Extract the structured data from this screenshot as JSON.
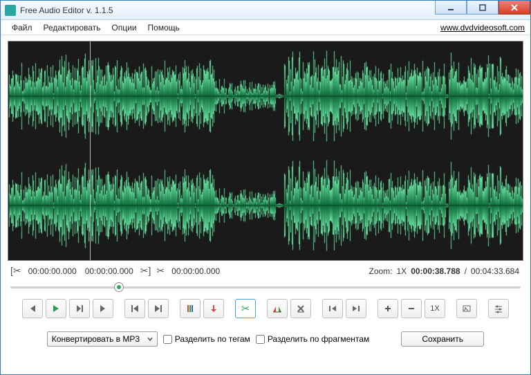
{
  "window": {
    "title": "Free Audio Editor v. 1.1.5"
  },
  "menu": {
    "file": "Файл",
    "edit": "Редактировать",
    "options": "Опции",
    "help": "Помощь",
    "link": "www.dvdvideosoft.com"
  },
  "selection": {
    "start": "00:00:00.000",
    "end": "00:00:00.000",
    "cursor": "00:00:00.000",
    "zoom_label": "Zoom:",
    "zoom_value": "1X",
    "position": "00:00:38.788",
    "sep": "/",
    "duration": "00:04:33.684"
  },
  "toolbar": {
    "zoom_reset": "1X"
  },
  "bottom": {
    "convert": "Конвертировать в MP3",
    "split_tags": "Разделить по тегам",
    "split_fragments": "Разделить по фрагментам",
    "save": "Сохранить"
  }
}
